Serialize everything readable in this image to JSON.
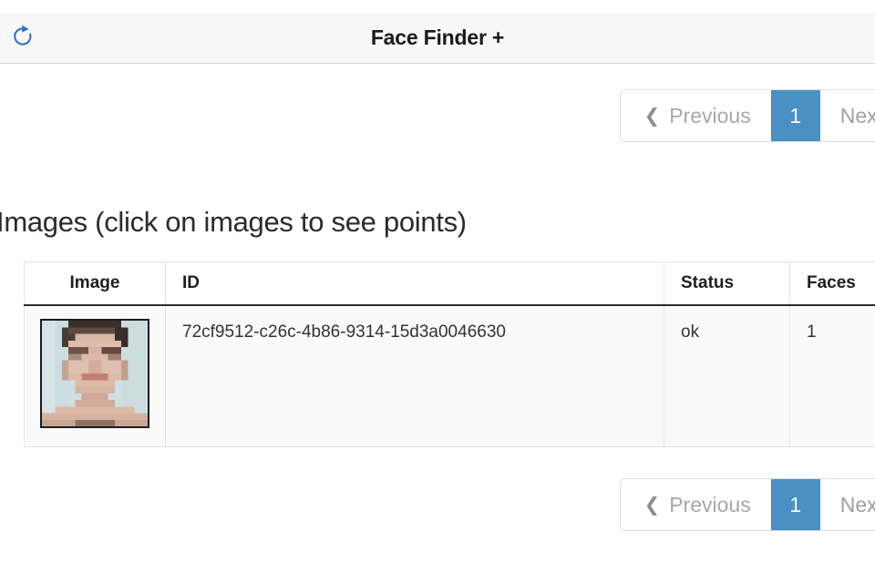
{
  "appbar": {
    "title": "Face Finder +",
    "refresh_icon": "refresh-icon",
    "refresh_color": "#2f72c7"
  },
  "pagination": {
    "previous_label": "Previous",
    "next_label": "Next",
    "current_page": "1",
    "prev_chevron": "❮",
    "active_color": "#4a90c4",
    "disabled_text_color": "#9a9a9a"
  },
  "main": {
    "section_title": "Images (click on images to see points)",
    "table": {
      "columns": [
        "Image",
        "ID",
        "Status",
        "Faces"
      ],
      "rows": [
        {
          "image_alt": "face-thumbnail",
          "id": "72cf9512-c26c-4b86-9314-15d3a0046630",
          "status": "ok",
          "faces": "1"
        }
      ]
    }
  }
}
